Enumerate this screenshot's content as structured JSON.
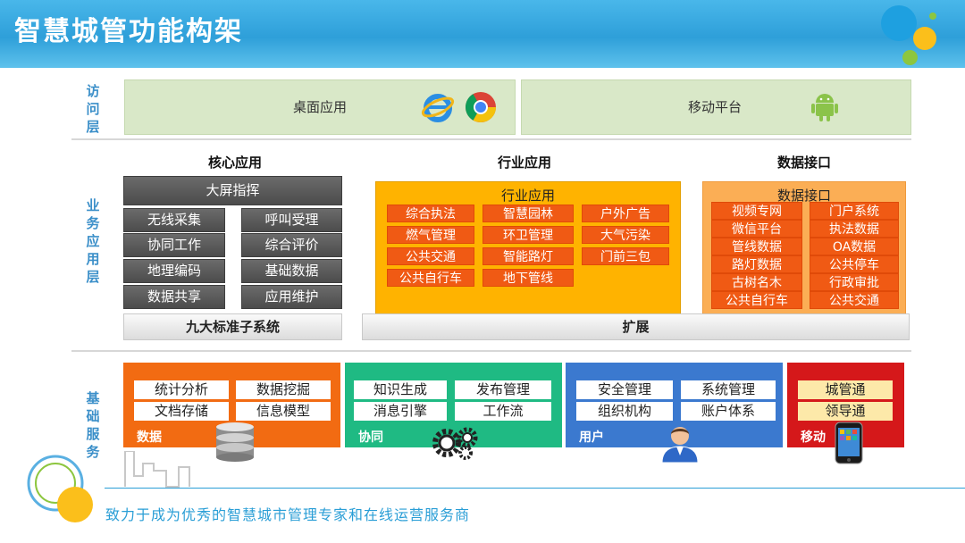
{
  "header": {
    "title": "智慧城管功能构架"
  },
  "layers": {
    "access": "访问层",
    "business": "业务应用层",
    "foundation": "基础服务"
  },
  "access": {
    "desktop": "桌面应用",
    "mobile": "移动平台"
  },
  "core": {
    "title": "核心应用",
    "big_screen": "大屏指挥",
    "items": [
      "无线采集",
      "呼叫受理",
      "协同工作",
      "综合评价",
      "地理编码",
      "基础数据",
      "数据共享",
      "应用维护"
    ],
    "footer": "九大标准子系统"
  },
  "industry": {
    "title": "行业应用",
    "box_title": "行业应用",
    "items": [
      "综合执法",
      "智慧园林",
      "户外广告",
      "燃气管理",
      "环卫管理",
      "大气污染",
      "公共交通",
      "智能路灯",
      "门前三包",
      "公共自行车",
      "地下管线"
    ]
  },
  "data_interface": {
    "title": "数据接口",
    "box_title": "数据接口",
    "items": [
      "视频专网",
      "门户系统",
      "微信平台",
      "执法数据",
      "管线数据",
      "OA数据",
      "路灯数据",
      "公共停车",
      "古树名木",
      "行政审批",
      "公共自行车",
      "公共交通"
    ]
  },
  "extend": {
    "label": "扩展"
  },
  "foundation": {
    "data": {
      "label": "数据",
      "items": [
        "统计分析",
        "数据挖掘",
        "文档存储",
        "信息模型"
      ],
      "color": "#f26b12"
    },
    "collab": {
      "label": "协同",
      "items": [
        "知识生成",
        "发布管理",
        "消息引擎",
        "工作流"
      ],
      "color": "#1fba83"
    },
    "user": {
      "label": "用户",
      "items": [
        "安全管理",
        "系统管理",
        "组织机构",
        "账户体系"
      ],
      "color": "#3b79cf"
    },
    "mobile": {
      "label": "移动",
      "items": [
        "城管通",
        "领导通"
      ],
      "color": "#d5181a"
    }
  },
  "footer": {
    "slogan": "致力于成为优秀的智慧城市管理专家和在线运营服务商"
  }
}
